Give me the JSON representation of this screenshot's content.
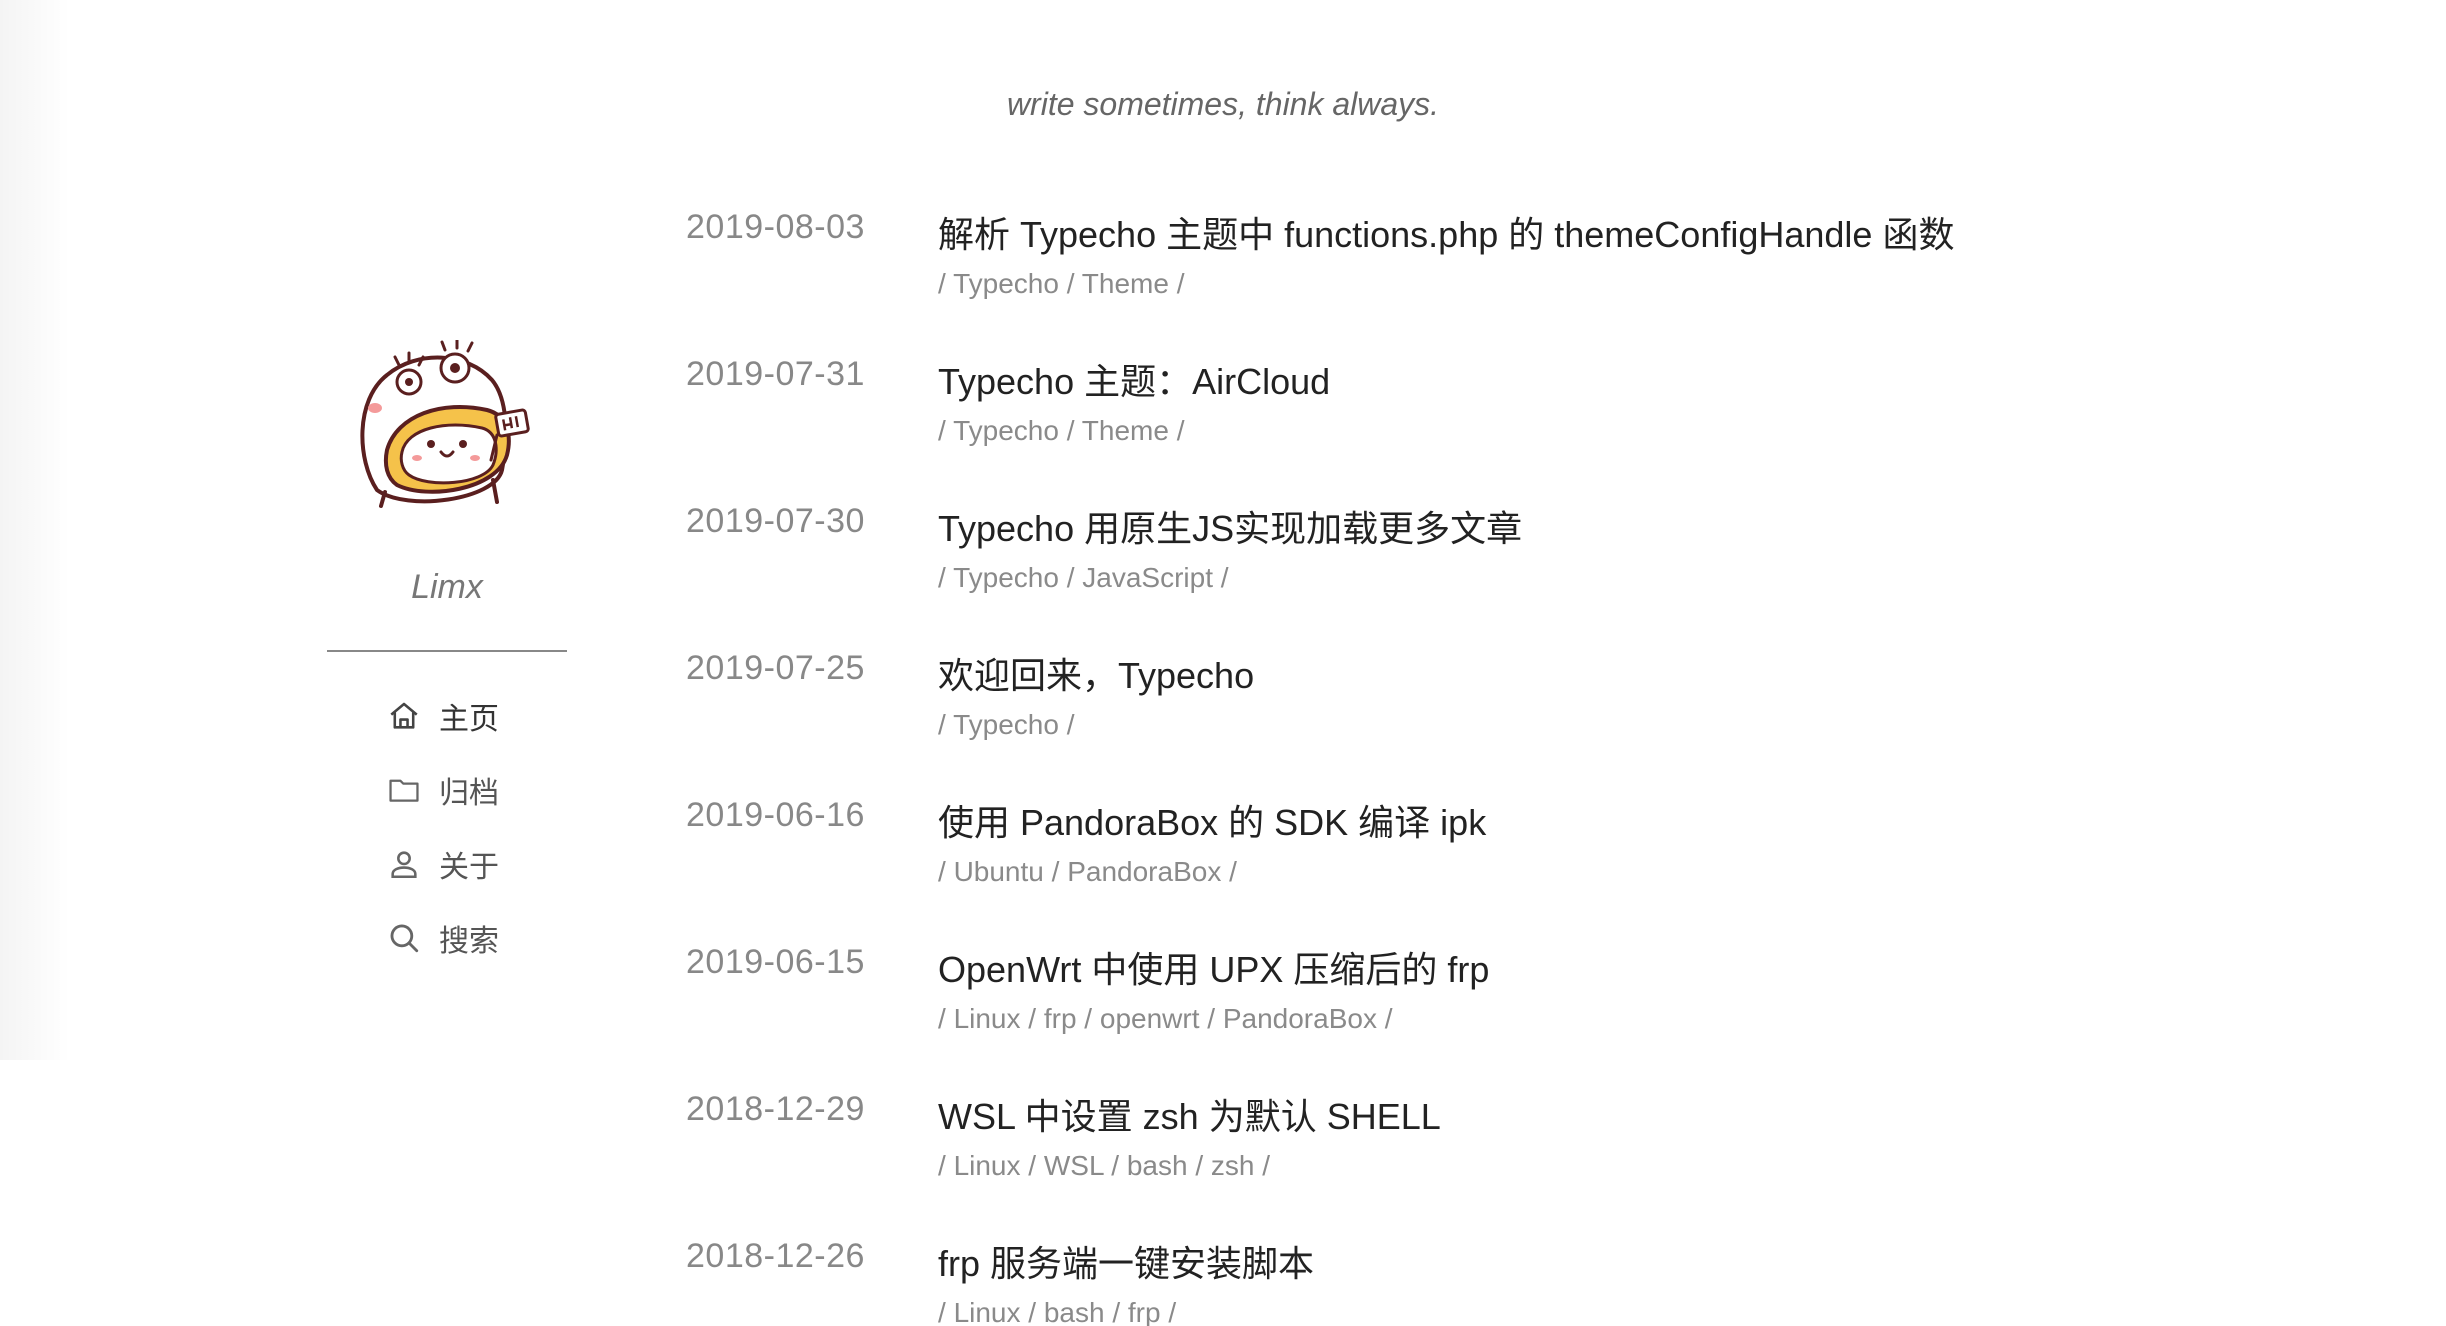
{
  "motto": "write sometimes, think always.",
  "author": {
    "name": "Limx"
  },
  "nav": [
    {
      "icon": "home-icon",
      "label": "主页"
    },
    {
      "icon": "folder-icon",
      "label": "归档"
    },
    {
      "icon": "user-icon",
      "label": "关于"
    },
    {
      "icon": "search-icon",
      "label": "搜索"
    }
  ],
  "posts": [
    {
      "date": "2019-08-03",
      "title": "解析 Typecho 主题中 functions.php 的 themeConfigHandle 函数",
      "tags": [
        "Typecho",
        "Theme"
      ]
    },
    {
      "date": "2019-07-31",
      "title": "Typecho 主题：AirCloud",
      "tags": [
        "Typecho",
        "Theme"
      ]
    },
    {
      "date": "2019-07-30",
      "title": "Typecho 用原生JS实现加载更多文章",
      "tags": [
        "Typecho",
        "JavaScript"
      ]
    },
    {
      "date": "2019-07-25",
      "title": "欢迎回来，Typecho",
      "tags": [
        "Typecho"
      ]
    },
    {
      "date": "2019-06-16",
      "title": "使用 PandoraBox 的 SDK 编译 ipk",
      "tags": [
        "Ubuntu",
        "PandoraBox"
      ]
    },
    {
      "date": "2019-06-15",
      "title": "OpenWrt 中使用 UPX 压缩后的 frp",
      "tags": [
        "Linux",
        "frp",
        "openwrt",
        "PandoraBox"
      ]
    },
    {
      "date": "2018-12-29",
      "title": "WSL 中设置 zsh 为默认 SHELL",
      "tags": [
        "Linux",
        "WSL",
        "bash",
        "zsh"
      ]
    },
    {
      "date": "2018-12-26",
      "title": "frp 服务端一键安装脚本",
      "tags": [
        "Linux",
        "bash",
        "frp"
      ]
    }
  ],
  "colors": {
    "background": "#ffffff",
    "title": "#222222",
    "muted": "#888888",
    "avatar_yellow": "#f5c24a",
    "avatar_outline": "#5a1f1f"
  }
}
